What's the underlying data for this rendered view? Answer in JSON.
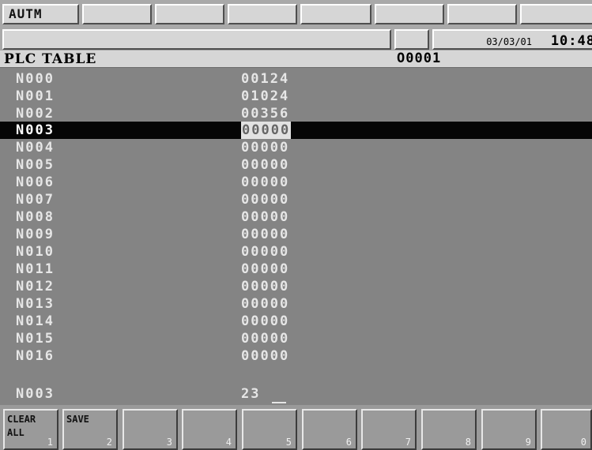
{
  "status": {
    "mode": "AUTM",
    "date": "03/03/01",
    "time": "10:48"
  },
  "header": {
    "title": "PLC  TABLE",
    "program_number": "O0001"
  },
  "table": {
    "rows": [
      {
        "address": "N000",
        "value": "00124"
      },
      {
        "address": "N001",
        "value": "01024"
      },
      {
        "address": "N002",
        "value": "00356"
      },
      {
        "address": "N003",
        "value": "00000"
      },
      {
        "address": "N004",
        "value": "00000"
      },
      {
        "address": "N005",
        "value": "00000"
      },
      {
        "address": "N006",
        "value": "00000"
      },
      {
        "address": "N007",
        "value": "00000"
      },
      {
        "address": "N008",
        "value": "00000"
      },
      {
        "address": "N009",
        "value": "00000"
      },
      {
        "address": "N010",
        "value": "00000"
      },
      {
        "address": "N011",
        "value": "00000"
      },
      {
        "address": "N012",
        "value": "00000"
      },
      {
        "address": "N013",
        "value": "00000"
      },
      {
        "address": "N014",
        "value": "00000"
      },
      {
        "address": "N015",
        "value": "00000"
      },
      {
        "address": "N016",
        "value": "00000"
      }
    ],
    "selected_index": 3
  },
  "input": {
    "address": "N003",
    "value": "23"
  },
  "softkeys": [
    {
      "label": "CLEAR\nALL",
      "number": "1"
    },
    {
      "label": "SAVE",
      "number": "2"
    },
    {
      "label": "",
      "number": "3"
    },
    {
      "label": "",
      "number": "4"
    },
    {
      "label": "",
      "number": "5"
    },
    {
      "label": "",
      "number": "6"
    },
    {
      "label": "",
      "number": "7"
    },
    {
      "label": "",
      "number": "8"
    },
    {
      "label": "",
      "number": "9"
    },
    {
      "label": "",
      "number": "0"
    }
  ],
  "colors": {
    "background": "#848484",
    "selected_row": "#050505",
    "text": "#e6e6e6"
  }
}
